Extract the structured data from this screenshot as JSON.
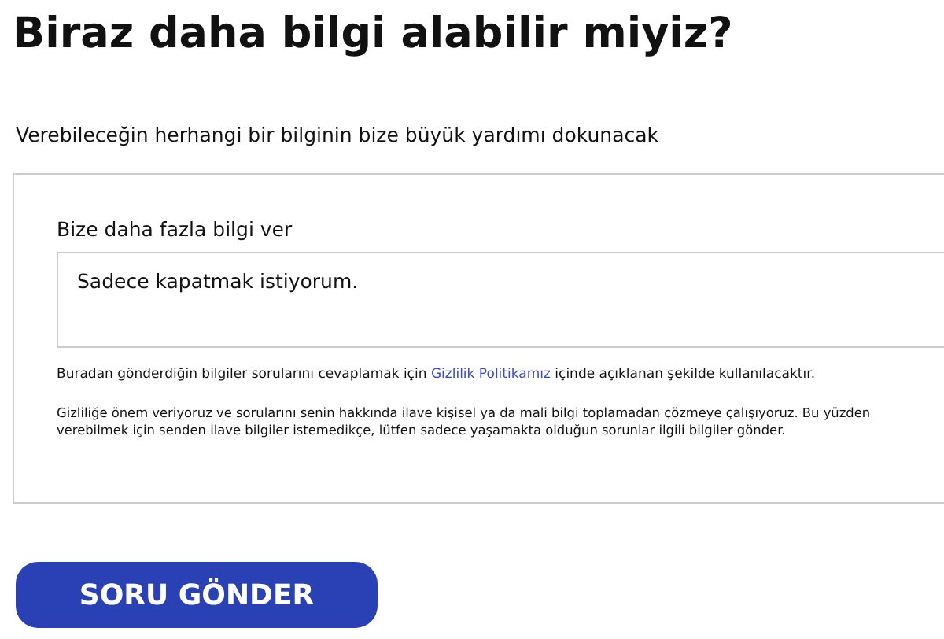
{
  "title": "Biraz daha bilgi alabilir miyiz?",
  "subtitle": "Verebileceğin herhangi bir bilginin bize büyük yardımı dokunacak",
  "form": {
    "field_label": "Bize daha fazla bilgi ver",
    "field_value": "Sadece kapatmak istiyorum.",
    "notice": {
      "before": "Buradan gönderdiğin bilgiler sorularını cevaplamak için",
      "link": "Gizlilik Politikamız",
      "after": "içinde açıklanan şekilde kullanılacaktır."
    },
    "privacy_note": "Gizliliğe önem veriyoruz ve sorularını senin hakkında ilave kişisel ya da mali bilgi toplamadan çözmeye çalışıyoruz. Bu yüzden verebilmek için senden ilave bilgiler istemedikçe, lütfen sadece yaşamakta olduğun sorunlar ilgili bilgiler gönder."
  },
  "submit_button": "SORU GÖNDER"
}
